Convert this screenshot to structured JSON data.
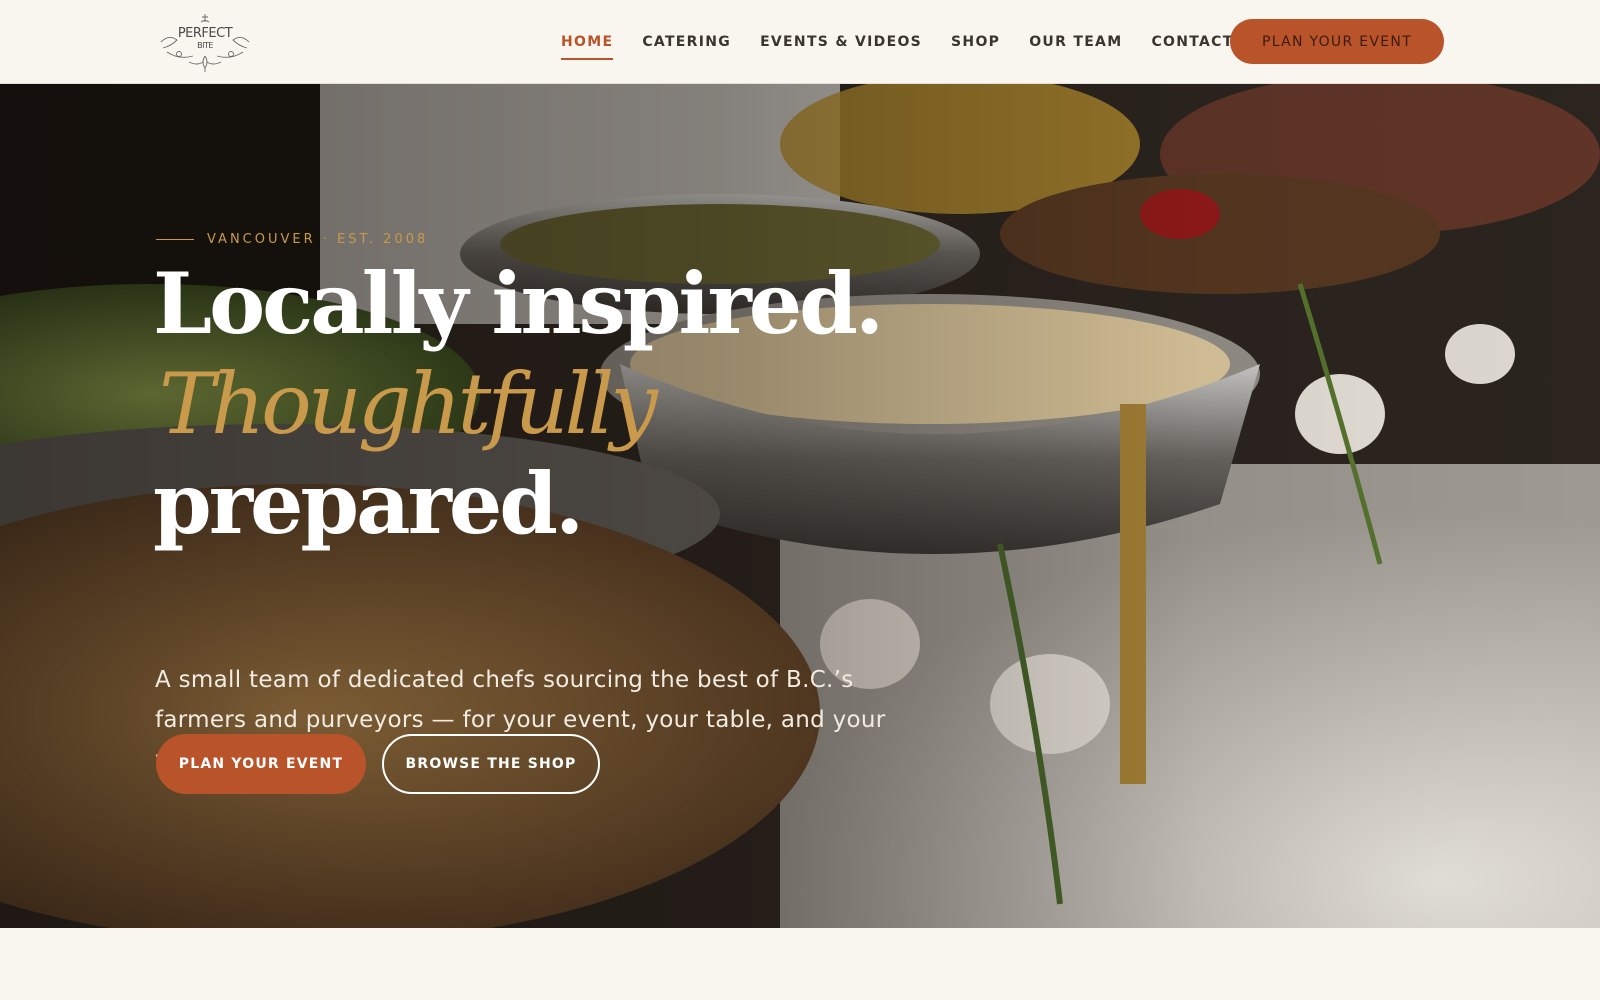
{
  "brand": {
    "logo_line1": "PERFECT",
    "logo_line2": "BITE"
  },
  "nav": {
    "items": [
      {
        "label": "HOME",
        "active": true
      },
      {
        "label": "CATERING",
        "active": false
      },
      {
        "label": "EVENTS & VIDEOS",
        "active": false
      },
      {
        "label": "SHOP",
        "active": false
      },
      {
        "label": "OUR TEAM",
        "active": false
      },
      {
        "label": "CONTACT",
        "active": false
      }
    ],
    "cta_label": "PLAN YOUR EVENT"
  },
  "hero": {
    "eyebrow": "VANCOUVER · EST. 2008",
    "headline_line1": "Locally inspired.",
    "headline_accent": "Thoughtfully",
    "headline_line3": "prepared.",
    "subtext": "A small team of dedicated chefs sourcing the best of B.C.’s farmers and purveyors — for your event, your table, and your weekend.",
    "primary_button": "PLAN YOUR EVENT",
    "secondary_button": "BROWSE THE SHOP"
  },
  "colors": {
    "accent": "#b9532a",
    "gold": "#c99a4b",
    "background": "#f9f6f0",
    "nav_text": "#3b3530"
  }
}
